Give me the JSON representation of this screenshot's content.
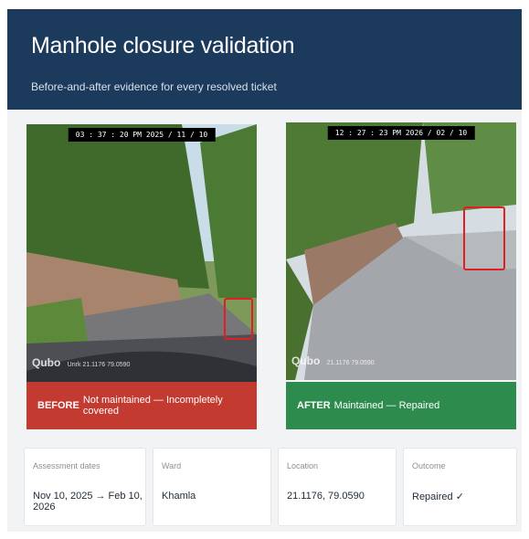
{
  "header": {
    "title": "Manhole closure validation",
    "subtitle": "Before-and-after evidence for every resolved ticket"
  },
  "before": {
    "timestamp": "03 : 37 : 20 PM 2025 / 11 / 10",
    "watermark": "Qubo",
    "coords": "Unrk 21.1176 79.0590",
    "tag": "BEFORE",
    "status": "Not maintained — Incompletely covered"
  },
  "after": {
    "timestamp": "12 : 27 : 23 PM 2026 / 02 / 10",
    "watermark": "Qubo",
    "coords": "21.1176 79.0590",
    "tag": "AFTER",
    "status": "Maintained — Repaired"
  },
  "info": {
    "dates_label": "Assessment dates",
    "dates_value": "Nov 10, 2025 → Feb 10, 2026",
    "ward_label": "Ward",
    "ward_value": "Khamla",
    "location_label": "Location",
    "location_value": "21.1176, 79.0590",
    "outcome_label": "Outcome",
    "outcome_value": "Repaired ✓"
  },
  "colors": {
    "header": "#1c3a5c",
    "before_band": "#c23a30",
    "after_band": "#2e8b4e",
    "highlight_box": "#e02020"
  }
}
